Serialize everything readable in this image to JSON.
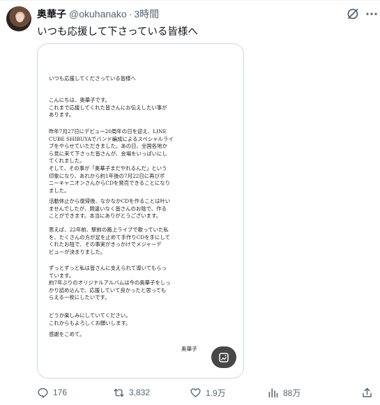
{
  "user": {
    "name": "奥華子",
    "handle": "@okuhanako",
    "separator": "·",
    "time": "3時間"
  },
  "tweet": {
    "text": "いつも応援して下さっている皆様へ"
  },
  "letter": {
    "title": "いつも応援してくださっている皆様へ",
    "p1": "こんにちは、奥華子です。\nこれまで応援してくれた皆さんにお伝えしたい事が\nあります。",
    "p2": "昨年7月27日にデビュー20周年の日を迎え、LINE\nCUBE SHIBUYAでバンド編成によるスペシャルライ\nブをやらせていただきました。あの日、全国各地か\nら見に来て下さった皆さんが、会場をいっぱいにし\nてくれました。\nそして、その事が「奥華子まだやれるんだ」という\n印象になり、あれから約1年後の7月22日に再びポ\nニーキャニオンさんからCDを発売できることになり\nました。",
    "p3": "活動休止から復帰後、なかなかCDを作ることは叶い\nませんでしたが、間違いなく皆さんのお陰で、作る\nことができます。本当にありがとうございます。",
    "p4": "思えば、22年前、駅前の路上ライブで歌っていた私\nを、たくさんの方が足を止めて手作りCDを手にして\nくれたお陰で、その事実がきっかけでメジャーデ\nビューが決まりました。",
    "p5": "ずっとずっと私は皆さんに支えられて導いてもらっ\nています。\n約7年ぶりのオリジナルアルバムは今の奥華子をしっ\nかり詰め込んで、応援していて良かったと思っても\nらえる一枚にしたいです。",
    "p6": "どうか楽しみにしていてください。\nこれからもよろしくお願いします。",
    "p7": "感謝をこめて。",
    "signature": "奥華子"
  },
  "actions": {
    "replies": "176",
    "reposts": "3,832",
    "likes": "1.9万",
    "views": "88万"
  },
  "icons": {
    "grok": "grok-icon",
    "more": "more-icon",
    "alt": "image-alt-icon",
    "reply": "reply-icon",
    "repost": "repost-icon",
    "like": "heart-icon",
    "views": "views-chart-icon",
    "share": "share-icon"
  },
  "colors": {
    "text": "#0f1419",
    "secondary": "#536471",
    "border": "#cfd9de"
  }
}
